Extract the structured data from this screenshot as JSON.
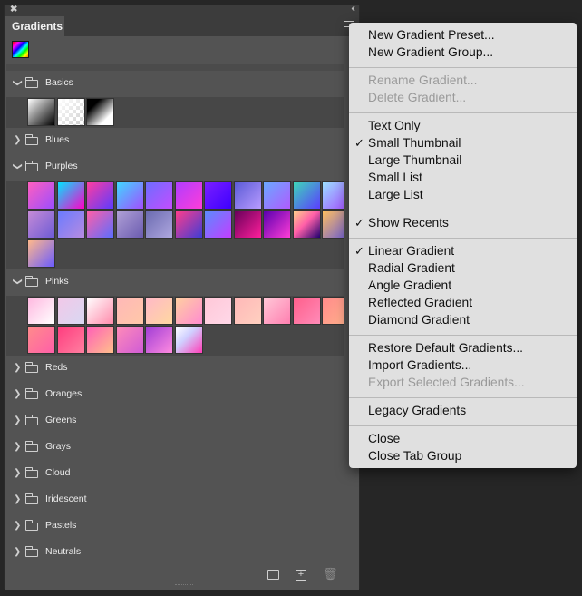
{
  "panel": {
    "close_glyph": "✖",
    "collapse_glyph": "‹‹",
    "tab_title": "Gradients"
  },
  "groups": [
    {
      "name": "Basics",
      "expanded": true,
      "thumbs": [
        "linear-gradient(135deg,#ffffff,#000000)",
        "linear-gradient(135deg,rgba(255,255,255,1) 0%,rgba(255,255,255,0) 100%), repeating-conic-gradient(#cfcfcf 0 25%,#ffffff 0 50%) 0 0/8px 8px",
        "linear-gradient(135deg,#000000 25%,#ffffff 75%)"
      ]
    },
    {
      "name": "Blues",
      "expanded": false,
      "thumbs": []
    },
    {
      "name": "Purples",
      "expanded": true,
      "thumbs": [
        "linear-gradient(135deg,#ff5fbf,#9b4dff)",
        "linear-gradient(135deg,#00e5ff,#ff00c8)",
        "linear-gradient(135deg,#ff3da0,#5b3bff)",
        "linear-gradient(135deg,#3fd8ff,#a34dff)",
        "linear-gradient(135deg,#6d6dff,#c44dff)",
        "linear-gradient(135deg,#b03dff,#ff3dd8)",
        "linear-gradient(135deg,#7a1fff,#3d00ff)",
        "linear-gradient(135deg,#5b5bd6,#b89bff)",
        "linear-gradient(135deg,#6aa8ff,#b05bff)",
        "linear-gradient(135deg,#3dd6b8,#5b3dff)",
        "linear-gradient(135deg,#9be0ff,#a34dff)",
        "linear-gradient(135deg,#c58bd6,#6d5bd6)",
        "linear-gradient(135deg,#6a7bff,#b88be0)",
        "linear-gradient(135deg,#ff5fa8,#5b6dff)",
        "linear-gradient(135deg,#b0a0d6,#6a5bb0)",
        "linear-gradient(135deg,#6a6ab0,#b0a8e0)",
        "linear-gradient(135deg,#ff3d8b,#3d3dd6)",
        "linear-gradient(135deg,#5b8bff,#c43dff)",
        "linear-gradient(135deg,#6a005b,#ff1f9b)",
        "linear-gradient(135deg,#5b00b0,#ff3dd6)",
        "linear-gradient(135deg,#ffcf8b,#ff5fa8 45%,#1f0070)",
        "linear-gradient(135deg,#ffbf5f,#6a5bd6)",
        "linear-gradient(135deg,#ffb88b,#6a5bff)"
      ]
    },
    {
      "name": "Pinks",
      "expanded": true,
      "thumbs": [
        "linear-gradient(135deg,#ffb8e0,#ffffff)",
        "linear-gradient(135deg,#f2c8e8,#d8d8f2)",
        "linear-gradient(135deg,#ffffff,#ff8bab)",
        "linear-gradient(135deg,#ffb8b8,#ffc8a8)",
        "linear-gradient(135deg,#ffb8c8,#ffd8a0)",
        "linear-gradient(135deg,#ffd0a0,#ff8bd0)",
        "linear-gradient(135deg,#ffc8d8,#ffd8e8)",
        "linear-gradient(135deg,#ffb8b8,#ffd0c0)",
        "linear-gradient(135deg,#ffc8d8,#ff7fb0)",
        "linear-gradient(135deg,#ff5f8b,#ff8bb8)",
        "linear-gradient(135deg,#ff8b8b,#ffb08b)",
        "linear-gradient(135deg,#ff8b8b,#ff5fa8)",
        "linear-gradient(135deg,#ff3d7f,#ff7fa0)",
        "linear-gradient(135deg,#ff5fb8,#ffc08b)",
        "linear-gradient(135deg,#ff8bb8,#d05bd6)",
        "linear-gradient(135deg,#a03dd6,#ff8be0)",
        "linear-gradient(135deg,#ffffff,#d0d0ff 40%,#ff3db8)"
      ]
    },
    {
      "name": "Reds",
      "expanded": false,
      "thumbs": []
    },
    {
      "name": "Oranges",
      "expanded": false,
      "thumbs": []
    },
    {
      "name": "Greens",
      "expanded": false,
      "thumbs": []
    },
    {
      "name": "Grays",
      "expanded": false,
      "thumbs": []
    },
    {
      "name": "Cloud",
      "expanded": false,
      "thumbs": []
    },
    {
      "name": "Iridescent",
      "expanded": false,
      "thumbs": []
    },
    {
      "name": "Pastels",
      "expanded": false,
      "thumbs": []
    },
    {
      "name": "Neutrals",
      "expanded": false,
      "thumbs": []
    }
  ],
  "menu": {
    "sections": [
      [
        {
          "label": "New Gradient Preset...",
          "disabled": false,
          "checked": false
        },
        {
          "label": "New Gradient Group...",
          "disabled": false,
          "checked": false
        }
      ],
      [
        {
          "label": "Rename Gradient...",
          "disabled": true,
          "checked": false
        },
        {
          "label": "Delete Gradient...",
          "disabled": true,
          "checked": false
        }
      ],
      [
        {
          "label": "Text Only",
          "disabled": false,
          "checked": false
        },
        {
          "label": "Small Thumbnail",
          "disabled": false,
          "checked": true
        },
        {
          "label": "Large Thumbnail",
          "disabled": false,
          "checked": false
        },
        {
          "label": "Small List",
          "disabled": false,
          "checked": false
        },
        {
          "label": "Large List",
          "disabled": false,
          "checked": false
        }
      ],
      [
        {
          "label": "Show Recents",
          "disabled": false,
          "checked": true
        }
      ],
      [
        {
          "label": "Linear Gradient",
          "disabled": false,
          "checked": true
        },
        {
          "label": "Radial Gradient",
          "disabled": false,
          "checked": false
        },
        {
          "label": "Angle Gradient",
          "disabled": false,
          "checked": false
        },
        {
          "label": "Reflected Gradient",
          "disabled": false,
          "checked": false
        },
        {
          "label": "Diamond Gradient",
          "disabled": false,
          "checked": false
        }
      ],
      [
        {
          "label": "Restore Default Gradients...",
          "disabled": false,
          "checked": false
        },
        {
          "label": "Import Gradients...",
          "disabled": false,
          "checked": false
        },
        {
          "label": "Export Selected Gradients...",
          "disabled": true,
          "checked": false
        }
      ],
      [
        {
          "label": "Legacy Gradients",
          "disabled": false,
          "checked": false
        }
      ],
      [
        {
          "label": "Close",
          "disabled": false,
          "checked": false
        },
        {
          "label": "Close Tab Group",
          "disabled": false,
          "checked": false
        }
      ]
    ]
  },
  "icons": {
    "check": "✓",
    "chevron_down": "❯",
    "new": "+",
    "trash": "🗑"
  }
}
